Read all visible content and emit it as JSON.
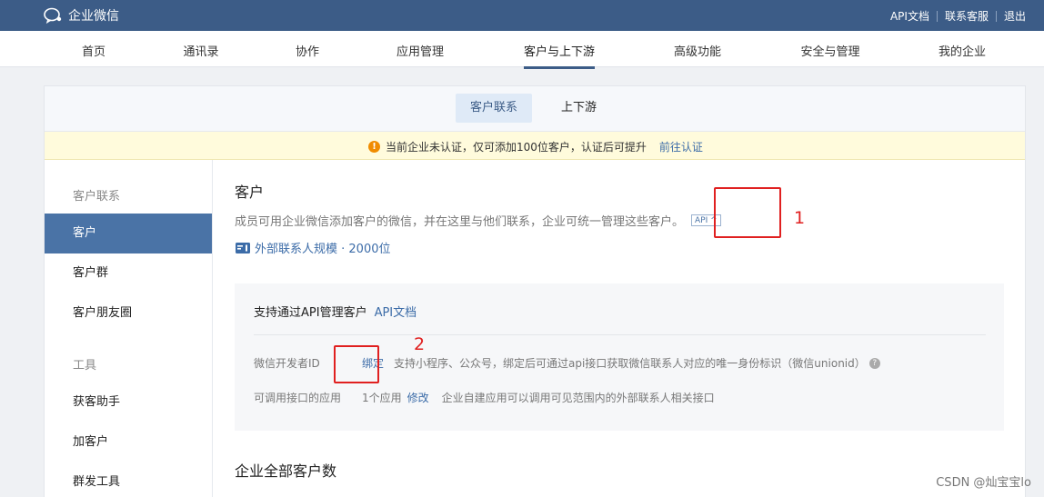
{
  "topbar": {
    "brand": "企业微信",
    "links": [
      "API文档",
      "联系客服",
      "退出"
    ]
  },
  "nav": {
    "tabs": [
      "首页",
      "通讯录",
      "协作",
      "应用管理",
      "客户与上下游",
      "高级功能",
      "安全与管理",
      "我的企业"
    ],
    "active": "客户与上下游"
  },
  "subtabs": [
    "客户联系",
    "上下游"
  ],
  "notice": {
    "text": "当前企业未认证，仅可添加100位客户，认证后可提升",
    "link": "前往认证"
  },
  "sidebar": {
    "group1": "客户联系",
    "group1_items": [
      "客户",
      "客户群",
      "客户朋友圈"
    ],
    "group2": "工具",
    "group2_items": [
      "获客助手",
      "加客户",
      "群发工具"
    ]
  },
  "main": {
    "title": "客户",
    "description": "成员可用企业微信添加客户的微信，并在这里与他们联系，企业可统一管理这些客户。",
    "api_tag": "API ^",
    "scale_link": "外部联系人规模 · 2000位",
    "panel": {
      "api_support": "支持通过API管理客户",
      "api_doc_link": "API文档",
      "dev_id_label": "微信开发者ID",
      "bind_link": "绑定",
      "bind_desc": "支持小程序、公众号，绑定后可通过api接口获取微信联系人对应的唯一身份标识（微信unionid）",
      "apps_label": "可调用接口的应用",
      "apps_count": "1个应用",
      "apps_edit": "修改",
      "apps_note": "企业自建应用可以调用可见范围内的外部联系人相关接口"
    },
    "total_title": "企业全部客户数"
  },
  "annotations": [
    "1",
    "2"
  ],
  "watermark": "CSDN @灿宝宝lo",
  "colors": {
    "topbar": "#3c5c87",
    "accent": "#4a73a6",
    "link": "#3c6ca8",
    "annotation": "#e02020"
  }
}
